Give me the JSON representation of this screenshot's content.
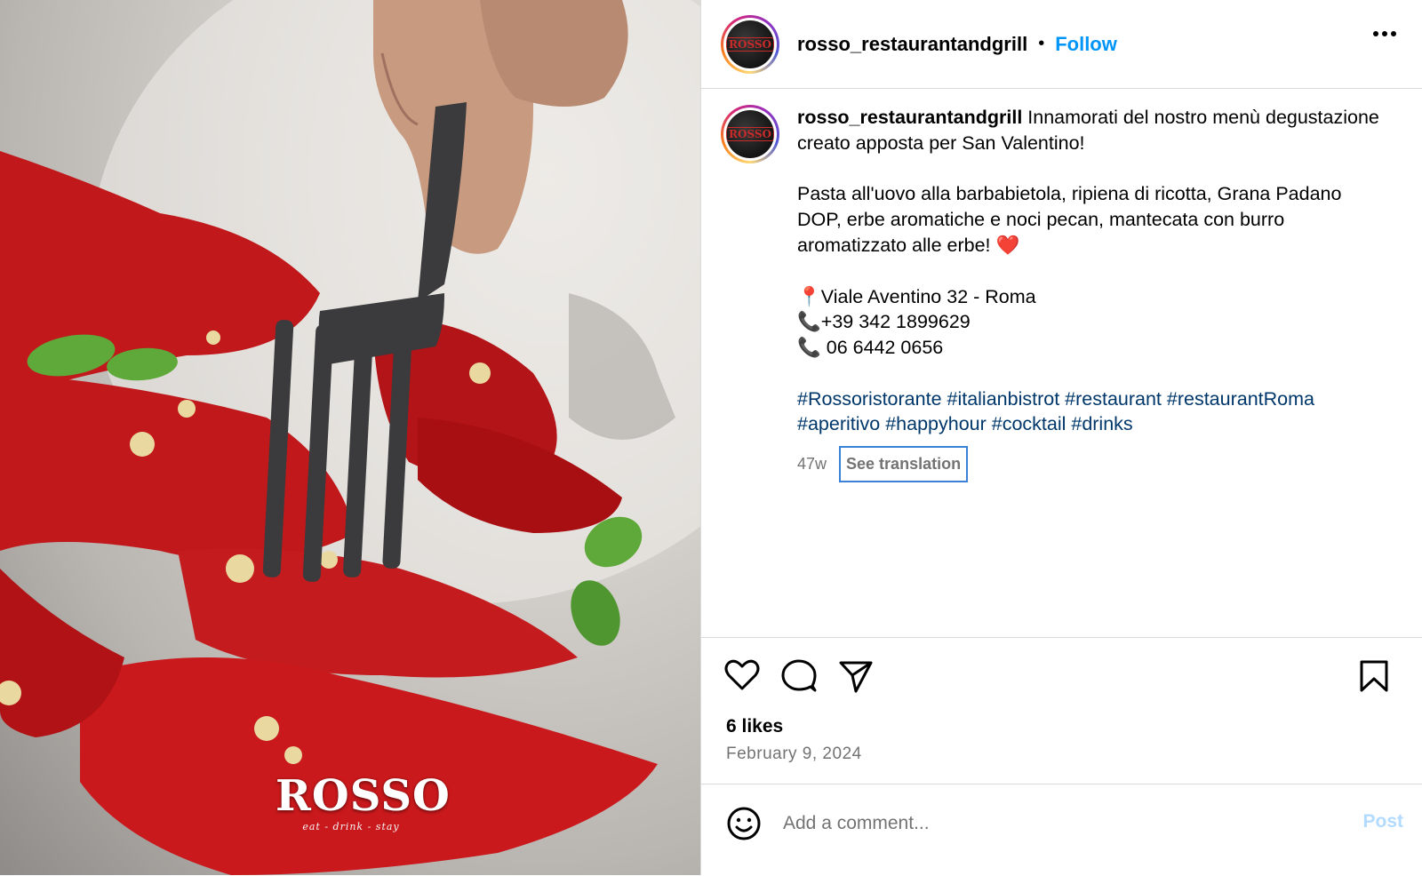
{
  "post": {
    "username": "rosso_restaurantandgrill",
    "separator": "•",
    "follow_label": "Follow",
    "more_icon": "more-options-icon",
    "avatar_text": "ROSSO"
  },
  "photo": {
    "logo_text": "ROSSO",
    "logo_tagline": "eat - drink - stay"
  },
  "caption": {
    "username": "rosso_restaurantandgrill",
    "line1": "Innamorati del nostro menù degustazione creato apposta per San Valentino!",
    "line2": "Pasta all'uovo alla barbabietola, ripiena di ricotta, Grana Padano DOP, erbe aromatiche e noci pecan, mantecata con burro aromatizzato alle erbe! ❤️",
    "address": "📍Viale Aventino 32 - Roma",
    "phone1": "📞+39 342 1899629",
    "phone2": "📞 06 6442 0656",
    "hashtags": "#Rossoristorante #italianbistrot #restaurant #restaurantRoma #aperitivo #happyhour #cocktail #drinks",
    "age": "47w",
    "see_translation": "See translation"
  },
  "engagement": {
    "likes": "6 likes",
    "date": "February 9, 2024"
  },
  "comment_box": {
    "placeholder": "Add a comment...",
    "post_label": "Post"
  },
  "colors": {
    "link_blue": "#0095f6",
    "hashtag": "#00376b",
    "muted": "#737373"
  }
}
